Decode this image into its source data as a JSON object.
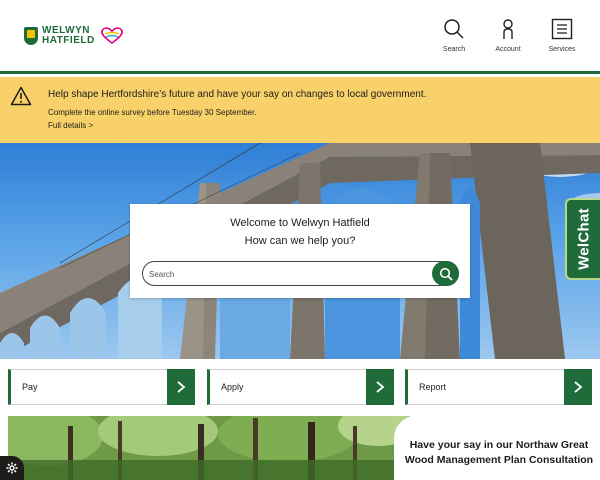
{
  "header": {
    "logo_line1": "WELWYN",
    "logo_line2": "HATFIELD",
    "nav": [
      {
        "label": "Search",
        "icon": "search-icon"
      },
      {
        "label": "Account",
        "icon": "account-icon"
      },
      {
        "label": "Services",
        "icon": "services-icon"
      }
    ]
  },
  "alert": {
    "title": "Help shape Hertfordshire’s future and have your say on changes to local government.",
    "subtitle": "Complete the online survey before Tuesday 30 September.",
    "link": "Full details >"
  },
  "hero": {
    "welcome_line1": "Welcome to Welwyn Hatfield",
    "welcome_line2": "How can we help you?",
    "search_placeholder": "Search"
  },
  "welchat": {
    "label": "WelChat"
  },
  "actions": [
    {
      "label": "Pay"
    },
    {
      "label": "Apply"
    },
    {
      "label": "Report"
    }
  ],
  "promo": {
    "title": "Have your say in our Northaw Great Wood Management Plan Consultation"
  },
  "colors": {
    "brand_green": "#1f6b3a",
    "alert_yellow": "#f8d16a",
    "welchat_border": "#b7d98c"
  }
}
